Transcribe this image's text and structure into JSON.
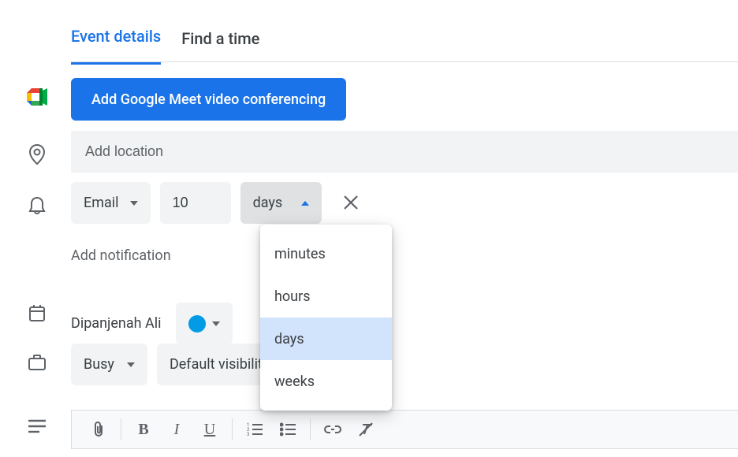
{
  "tabs": {
    "details": "Event details",
    "findtime": "Find a time"
  },
  "meet": {
    "button": "Add Google Meet video conferencing"
  },
  "location": {
    "placeholder": "Add location",
    "value": ""
  },
  "notification": {
    "method": "Email",
    "amount": "10",
    "unit": "days",
    "units_menu": [
      "minutes",
      "hours",
      "days",
      "weeks"
    ],
    "add_label": "Add notification"
  },
  "owner": {
    "name": "Dipanjenah Ali",
    "color": "#039be5"
  },
  "availability": {
    "busy": "Busy",
    "visibility": "Default visibility"
  }
}
